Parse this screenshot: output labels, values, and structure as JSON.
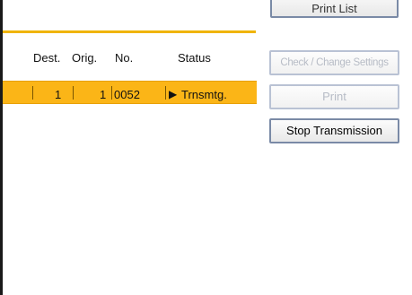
{
  "buttons": {
    "print_list": "Print List",
    "check_change_settings": "Check / Change Settings",
    "print": "Print",
    "stop_transmission": "Stop Transmission"
  },
  "table": {
    "columns": [
      "Dest.",
      "Orig.",
      "No.",
      "Status"
    ],
    "rows": [
      {
        "dest": "1",
        "orig": "1",
        "no": "0052",
        "status_icon": "play-triangle-icon",
        "status": "Trnsmtg.",
        "selected": true
      }
    ]
  },
  "colors": {
    "highlight": "#fbb517",
    "divider": "#f0b400",
    "disabled_text": "#b7bcc6"
  }
}
